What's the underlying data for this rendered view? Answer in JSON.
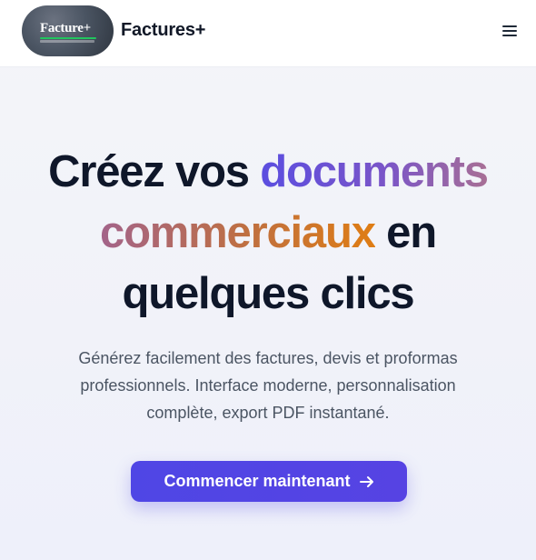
{
  "nav": {
    "logo_text": "Facture+",
    "brand": "Factures+",
    "menu_icon": "hamburger-menu-icon"
  },
  "hero": {
    "title_part1": "Créez vos ",
    "title_highlight1": "documents",
    "title_highlight2": "commerciaux",
    "title_part2": " en",
    "title_part3": "quelques clics",
    "subtitle": "Générez facilement des factures, devis et proformas professionnels. Interface moderne, personnalisation complète, export PDF instantané.",
    "cta_label": "Commencer maintenant",
    "cta_icon": "arrow-right-icon"
  },
  "colors": {
    "accent": "#4f46e5",
    "highlight_purple": "#6d55d6",
    "highlight_orange": "#df7d14",
    "title_text": "#0f172a",
    "body_text": "#4b5563"
  }
}
